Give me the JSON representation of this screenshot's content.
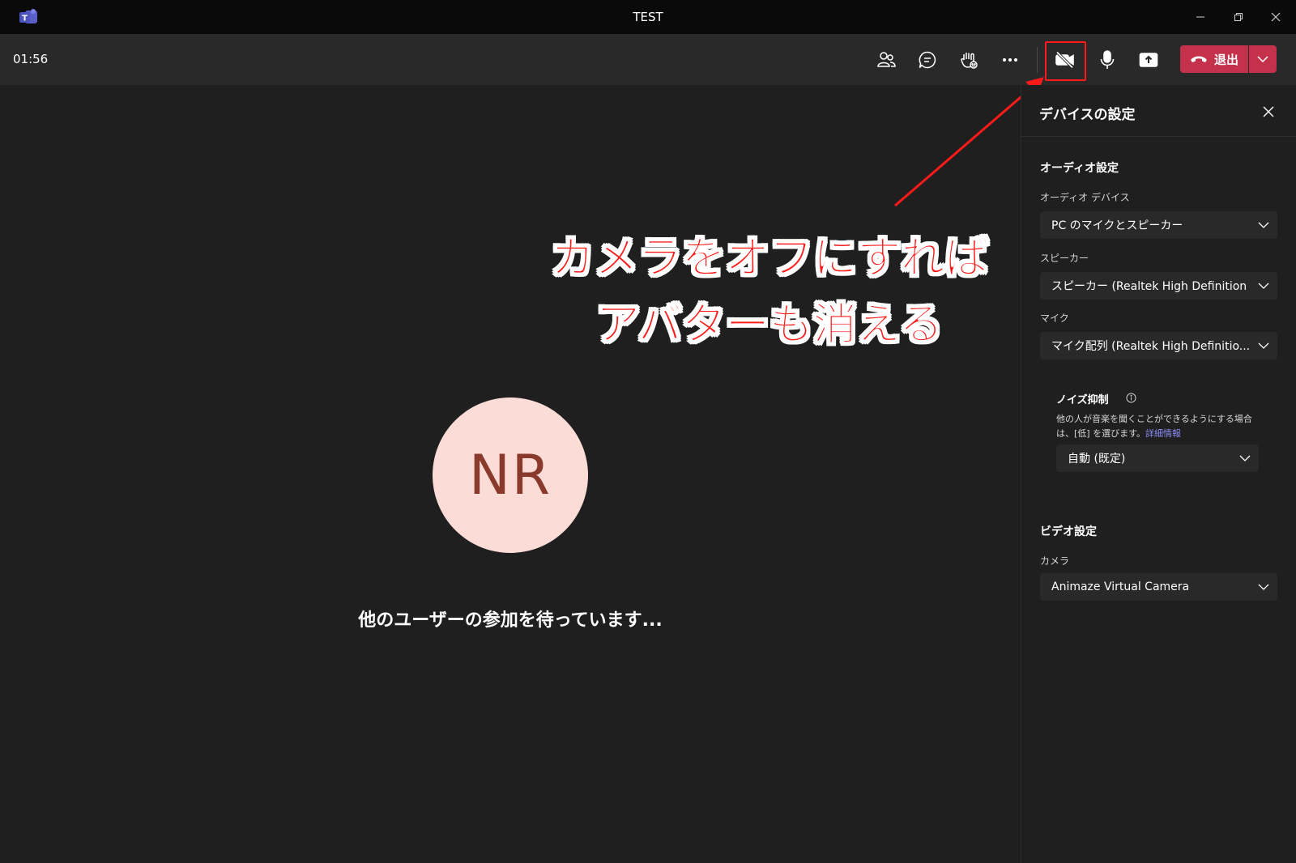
{
  "window": {
    "title": "TEST",
    "controls": {
      "minimize": "minimize-icon",
      "restore": "restore-icon",
      "close": "close-icon"
    }
  },
  "toolbar": {
    "timer": "01:56",
    "leave_label": "退出"
  },
  "stage": {
    "avatar_initials": "NR",
    "waiting_text": "他のユーザーの参加を待っています..."
  },
  "annotation": {
    "line1": "カメラをオフにすれば",
    "line2": "アバターも消える",
    "color": "#ff1a1a"
  },
  "panel": {
    "title": "デバイスの設定",
    "audio": {
      "heading": "オーディオ設定",
      "device_label": "オーディオ デバイス",
      "device_value": "PC のマイクとスピーカー",
      "speaker_label": "スピーカー",
      "speaker_value": "スピーカー (Realtek High Definition ...",
      "mic_label": "マイク",
      "mic_value": "マイク配列 (Realtek High Definitio..."
    },
    "noise": {
      "title": "ノイズ抑制",
      "desc_line1": "他の人が音楽を聞くことができるようにする場合",
      "desc_line2": "は、[低] を選びます。",
      "link": "詳細情報",
      "value": "自動 (既定)"
    },
    "video": {
      "heading": "ビデオ設定",
      "camera_label": "カメラ",
      "camera_value": "Animaze Virtual Camera"
    }
  },
  "colors": {
    "leave": "#c4314b",
    "link": "#8b8cf3",
    "avatar_bg": "#fcdcd6",
    "avatar_text": "#8a3a2d"
  }
}
